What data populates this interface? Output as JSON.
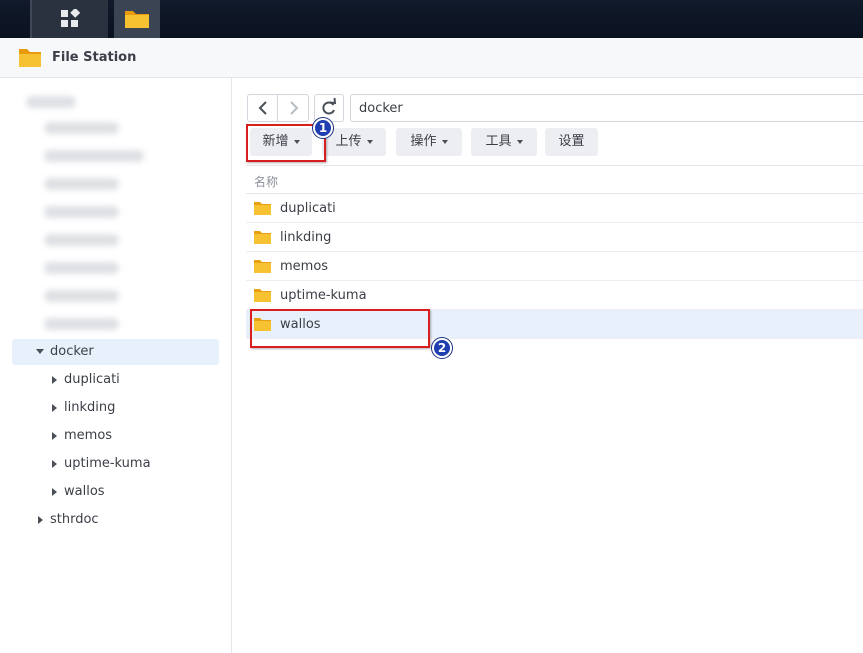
{
  "taskbar": {
    "apps": [
      {
        "icon": "grid-apps-icon"
      },
      {
        "icon": "folder-icon"
      }
    ]
  },
  "window": {
    "title": "File Station",
    "icon": "folder-icon"
  },
  "toolbar": {
    "back_icon": "chevron-left-icon",
    "forward_icon": "chevron-right-icon",
    "refresh_icon": "refresh-icon",
    "path": "docker",
    "buttons": [
      {
        "label": "新增",
        "has_dropdown": true
      },
      {
        "label": "上传",
        "has_dropdown": true
      },
      {
        "label": "操作",
        "has_dropdown": true
      },
      {
        "label": "工具",
        "has_dropdown": true
      },
      {
        "label": "设置",
        "has_dropdown": false
      }
    ]
  },
  "tree": {
    "expanded_folder": "docker",
    "children": [
      "duplicati",
      "linkding",
      "memos",
      "uptime-kuma",
      "wallos"
    ],
    "collapsed_sibling": "sthrdoc"
  },
  "file_list": {
    "column_name": "名称",
    "items": [
      {
        "name": "duplicati",
        "selected": false
      },
      {
        "name": "linkding",
        "selected": false
      },
      {
        "name": "memos",
        "selected": false
      },
      {
        "name": "uptime-kuma",
        "selected": false
      },
      {
        "name": "wallos",
        "selected": true
      }
    ]
  },
  "annotations": {
    "badge_1": "1",
    "badge_2": "2"
  },
  "colors": {
    "accent": "#1f3fb0",
    "highlight_box": "#d81e1e",
    "selection": "#e8f1fb",
    "folder": "#f5b81a"
  }
}
